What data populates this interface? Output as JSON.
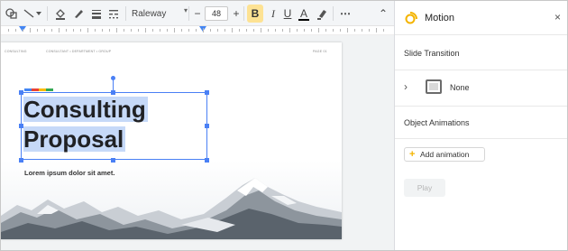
{
  "toolbar": {
    "font_name": "Raleway",
    "font_size": "48",
    "minus_label": "−",
    "plus_label": "+",
    "bold_label": "B",
    "italic_label": "I",
    "underline_label": "U",
    "text_color_label": "A",
    "more_label": "⋯",
    "collapse_label": "⌃",
    "colors": {
      "highlight": "#fde293",
      "text_color_bar": "#000000"
    }
  },
  "slide": {
    "header_left": "CONSULTING",
    "header_mid": "CONSULTANT • DEPARTMENT • GROUP",
    "header_right": "PAGE 01",
    "title_line1": "Consulting",
    "title_line2": "Proposal",
    "subtitle": "Lorem ipsum dolor sit amet.",
    "accent_colors": [
      "#4285f4",
      "#ea4335",
      "#fbbc04",
      "#34a853"
    ],
    "selection_color": "#4a80f5",
    "text_selection_bg": "#c6d9f8"
  },
  "panel": {
    "icon": "motion-icon",
    "title": "Motion",
    "close_label": "×",
    "slide_transition_label": "Slide Transition",
    "transition_value": "None",
    "object_animations_label": "Object Animations",
    "add_animation_label": "Add animation",
    "play_label": "Play"
  }
}
